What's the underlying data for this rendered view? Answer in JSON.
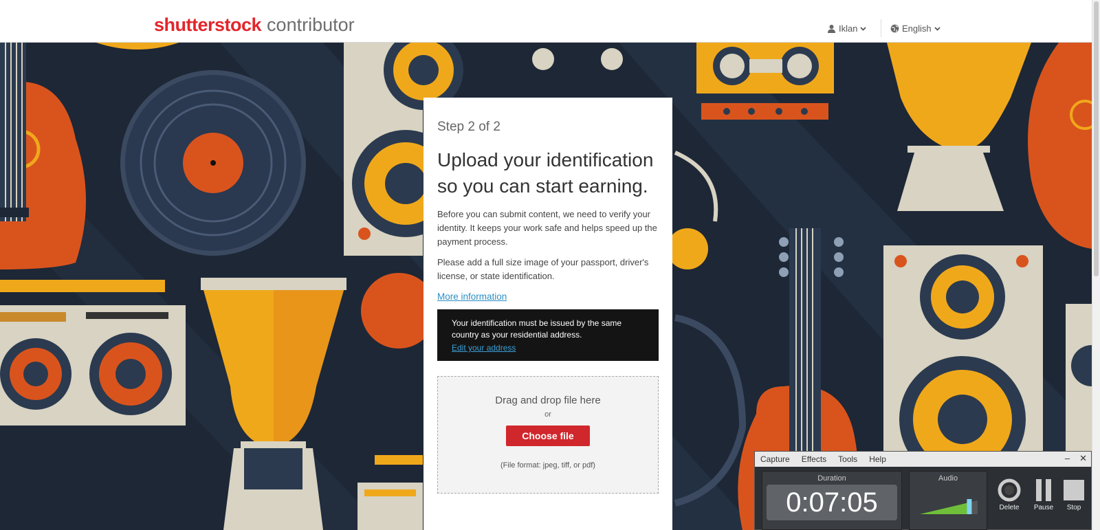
{
  "header": {
    "logo_brand": "shutterstock",
    "logo_sub": "contributor",
    "user_label": "Iklan",
    "language_label": "English"
  },
  "card": {
    "step": "Step 2 of 2",
    "title": "Upload your identification so you can start earning.",
    "intro": "Before you can submit content, we need to verify your identity. It keeps your work safe and helps speed up the payment process.",
    "instruction": "Please add a full size image of your passport, driver's license, or state identification.",
    "more_link": "More information",
    "notice_text": "Your identification must be issued by the same country as your residential address.",
    "notice_link": "Edit your address"
  },
  "upload": {
    "drag_text": "Drag and drop file here",
    "or_text": "or",
    "button_label": "Choose file",
    "format_text": "(File format: jpeg, tiff, or pdf)"
  },
  "recorder": {
    "menu": [
      "Capture",
      "Effects",
      "Tools",
      "Help"
    ],
    "minimize": "–",
    "close": "✕",
    "duration_label": "Duration",
    "duration_value": "0:07:05",
    "audio_label": "Audio",
    "audio_level": 0.85,
    "buttons": {
      "delete": "Delete",
      "pause": "Pause",
      "stop": "Stop"
    }
  },
  "colors": {
    "brand_red": "#e3262b",
    "link_blue": "#2a8ec4",
    "background_navy": "#1d2736",
    "art_orange": "#d9541d",
    "art_yellow": "#f0a81b",
    "art_cream": "#d8d3c2"
  }
}
